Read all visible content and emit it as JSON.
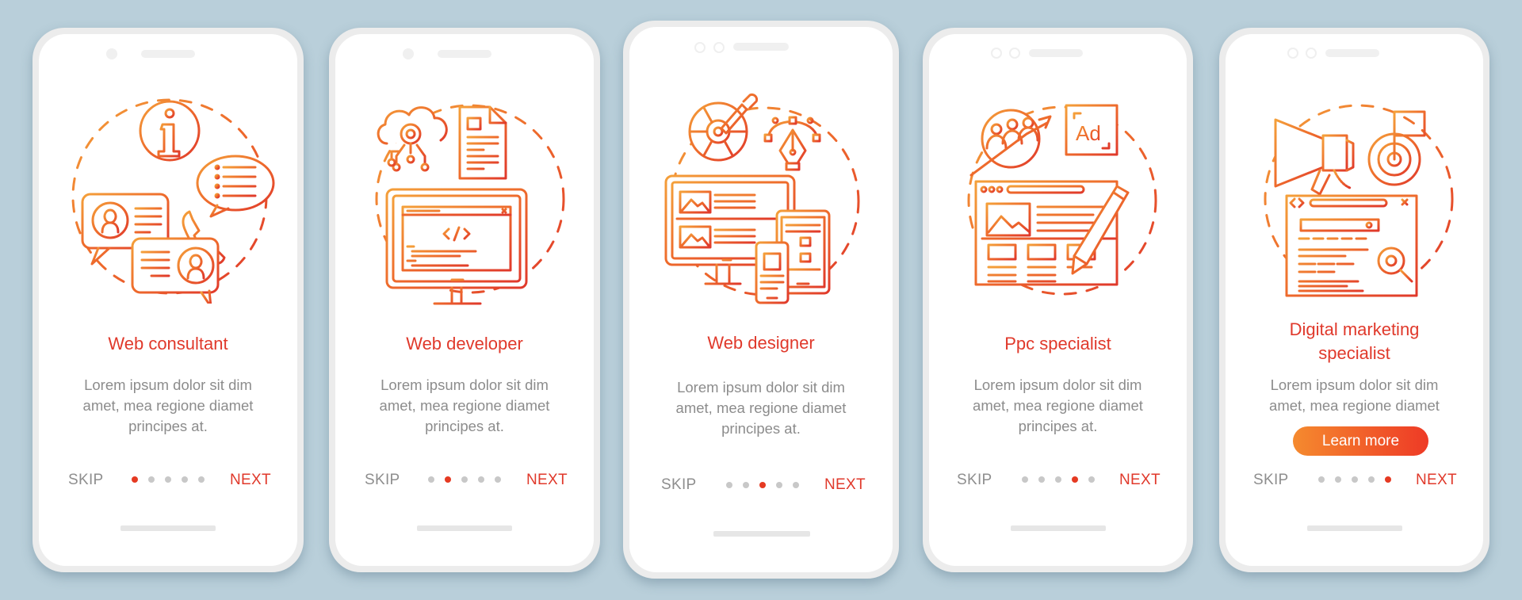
{
  "colors": {
    "background": "#B9CFDA",
    "accent_red": "#E0392B",
    "gradient_start": "#F4902E",
    "gradient_end": "#E53A22",
    "body_text": "#8C8C8C",
    "dot_inactive": "#C8C8C8"
  },
  "screens": [
    {
      "icon": "web-consultant-icon",
      "title": "Web consultant",
      "body": [
        "Lorem ipsum dolor sit dim",
        "amet, mea regione diamet",
        "principes at."
      ],
      "skip_label": "SKIP",
      "next_label": "NEXT",
      "page_index": 1,
      "page_count": 5
    },
    {
      "icon": "web-developer-icon",
      "title": "Web developer",
      "body": [
        "Lorem ipsum dolor sit dim",
        "amet, mea regione diamet",
        "principes at."
      ],
      "skip_label": "SKIP",
      "next_label": "NEXT",
      "page_index": 2,
      "page_count": 5
    },
    {
      "icon": "web-designer-icon",
      "title": "Web designer",
      "body": [
        "Lorem ipsum dolor sit dim",
        "amet, mea regione diamet",
        "principes at."
      ],
      "skip_label": "SKIP",
      "next_label": "NEXT",
      "page_index": 3,
      "page_count": 5
    },
    {
      "icon": "ppc-specialist-icon",
      "title": "Ppc specialist",
      "body": [
        "Lorem ipsum dolor sit dim",
        "amet, mea regione diamet",
        "principes at."
      ],
      "skip_label": "SKIP",
      "next_label": "NEXT",
      "page_index": 4,
      "page_count": 5
    },
    {
      "icon": "digital-marketing-icon",
      "title": [
        "Digital marketing",
        "specialist"
      ],
      "body": [
        "Lorem ipsum dolor sit dim",
        "amet, mea regione diamet"
      ],
      "button_label": "Learn more",
      "skip_label": "SKIP",
      "next_label": "NEXT",
      "page_index": 5,
      "page_count": 5
    }
  ]
}
